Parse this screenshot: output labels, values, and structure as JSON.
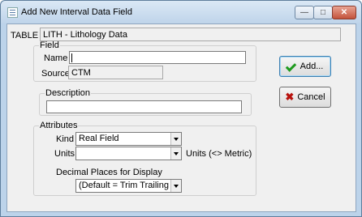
{
  "window": {
    "title": "Add New Interval Data Field"
  },
  "table": {
    "label": "TABLE",
    "value": "LITH - Lithology Data"
  },
  "field_group": {
    "legend": "Field",
    "name_label": "Name",
    "name_value": "",
    "source_label": "Source",
    "source_value": "CTM"
  },
  "description_group": {
    "legend": "Description",
    "value": ""
  },
  "attributes": {
    "legend": "Attributes",
    "kind_label": "Kind",
    "kind_value": "Real Field",
    "units_label": "Units",
    "units_value": "",
    "units_note": "Units (<> Metric)",
    "decimal_label": "Decimal Places for Display",
    "decimal_value": "(Default = Trim Trailing Ze"
  },
  "buttons": {
    "add_label": "Add...",
    "cancel_label": "Cancel"
  }
}
